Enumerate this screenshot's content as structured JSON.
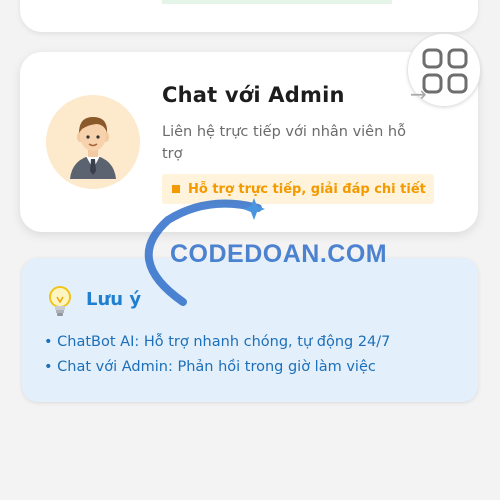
{
  "admin_card": {
    "title": "Chat với Admin",
    "description": "Liên hệ trực tiếp với nhân viên hỗ trợ",
    "badge": "Hỗ trợ trực tiếp, giải đáp chi tiết",
    "avatar_icon": "businessman-avatar-icon",
    "grid_icon": "grid-four-squares-icon",
    "arrow_icon": "right-arrow-icon"
  },
  "note_card": {
    "title": "Lưu ý",
    "icon": "lightbulb-icon",
    "lines": [
      "• ChatBot AI: Hỗ trợ nhanh chóng, tự động 24/7",
      "• Chat với Admin: Phản hồi trong giờ làm việc"
    ]
  },
  "watermark": {
    "text": "CODEDOAN.COM"
  },
  "colors": {
    "badge_text": "#f39a00",
    "badge_bg": "#fff3dc",
    "note_bg": "#e3f0fb",
    "note_text": "#1c6fb8",
    "avatar_bg": "#fde9cc"
  }
}
